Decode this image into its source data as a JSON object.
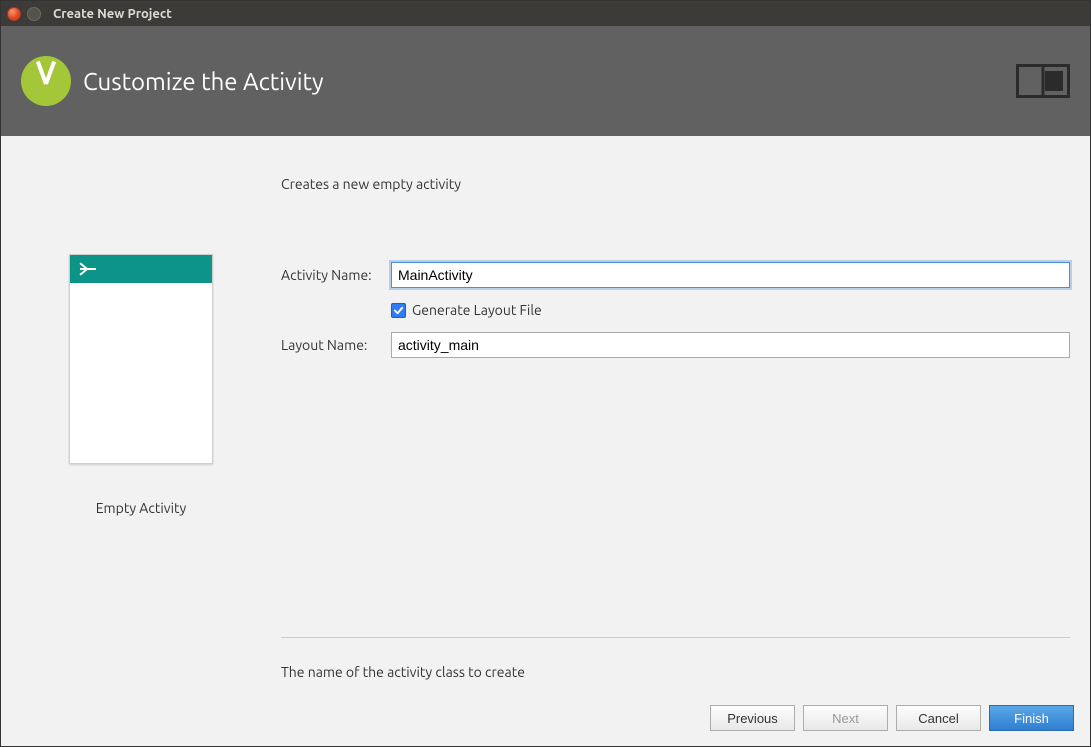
{
  "window": {
    "title": "Create New Project"
  },
  "header": {
    "title": "Customize the Activity"
  },
  "preview": {
    "caption": "Empty Activity"
  },
  "form": {
    "description": "Creates a new empty activity",
    "activity_label": "Activity Name:",
    "activity_value": "MainActivity",
    "generate_label": "Generate Layout File",
    "generate_checked": true,
    "layout_label": "Layout Name:",
    "layout_value": "activity_main",
    "hint": "The name of the activity class to create"
  },
  "buttons": {
    "previous": "Previous",
    "next": "Next",
    "cancel": "Cancel",
    "finish": "Finish"
  }
}
